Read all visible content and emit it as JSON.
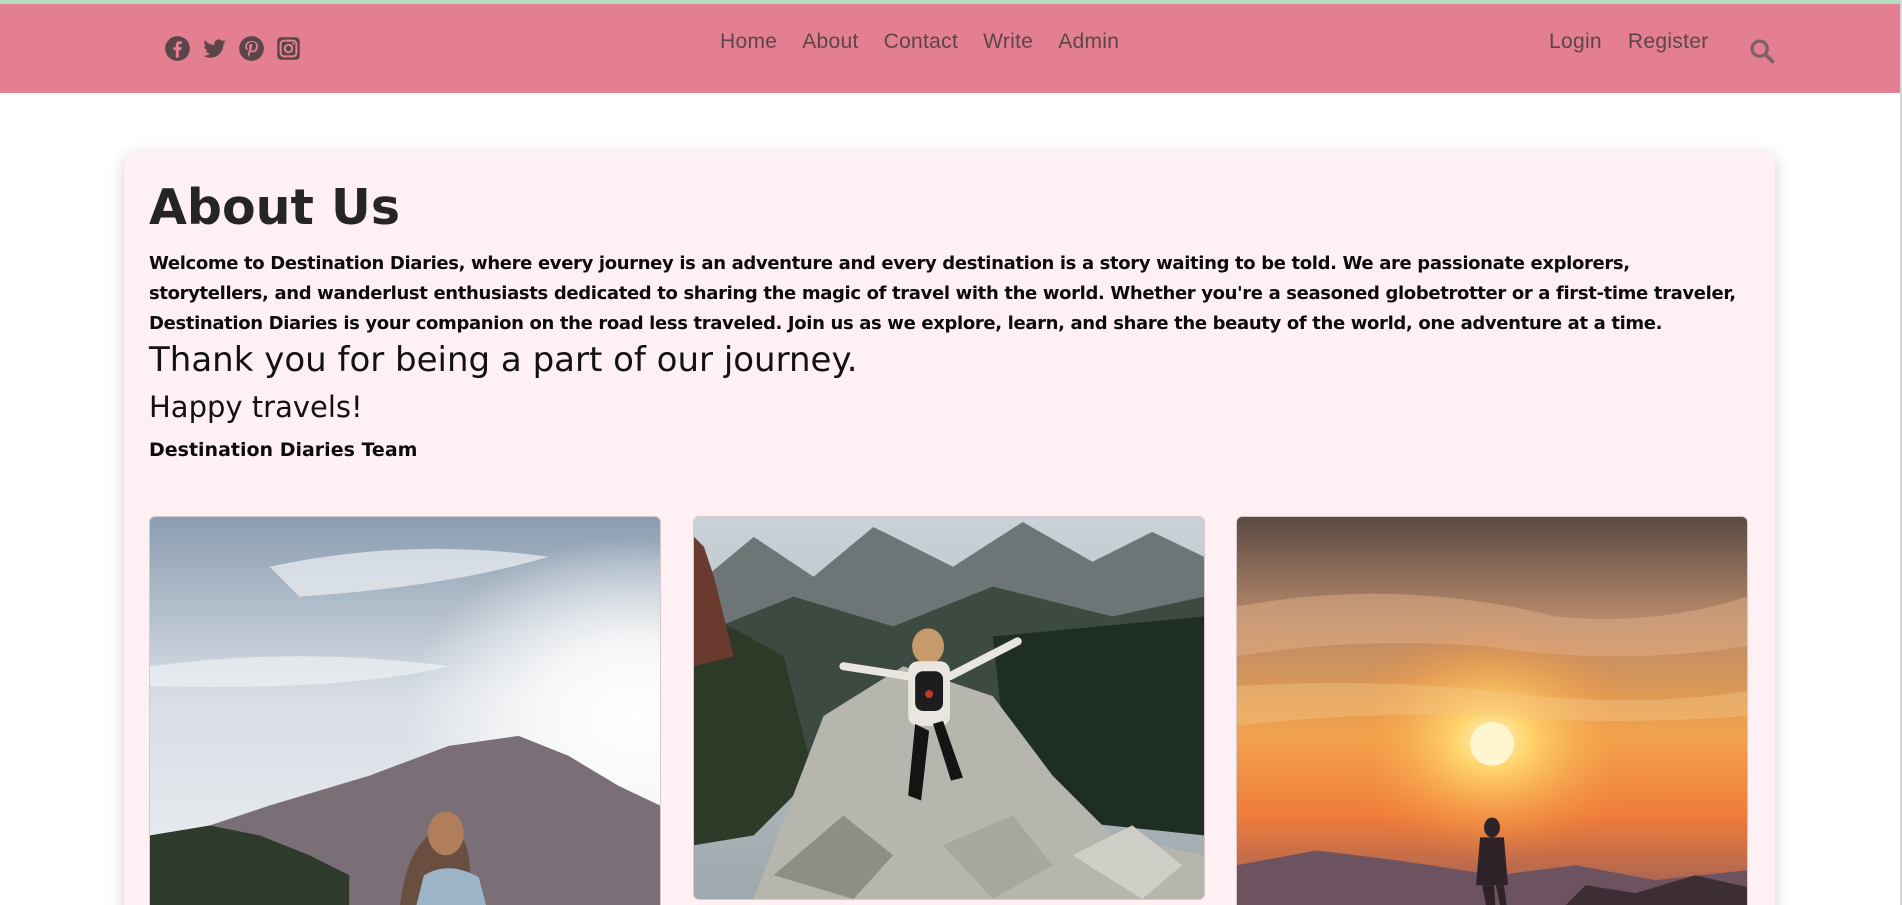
{
  "social": {
    "icons": [
      "facebook-icon",
      "twitter-icon",
      "pinterest-icon",
      "instagram-icon"
    ]
  },
  "nav": {
    "center": [
      "Home",
      "About",
      "Contact",
      "Write",
      "Admin"
    ],
    "right": [
      "Login",
      "Register"
    ],
    "search_icon": "search-icon"
  },
  "colors": {
    "navbar": "#e37f91",
    "card_background": "#fff0f4",
    "accent_line": "#b4dcc0"
  },
  "about": {
    "title": "About Us",
    "intro": "Welcome to Destination Diaries, where every journey is an adventure and every destination is a story waiting to be told. We are passionate explorers, storytellers, and wanderlust enthusiasts dedicated to sharing the magic of travel with the world. Whether you're a seasoned globetrotter or a first-time traveler, Destination Diaries is your companion on the road less traveled. Join us as we explore, learn, and share the beauty of the world, one adventure at a time.",
    "thanks": "Thank you for being a part of our journey.",
    "happy": "Happy travels!",
    "team": "Destination Diaries Team"
  }
}
